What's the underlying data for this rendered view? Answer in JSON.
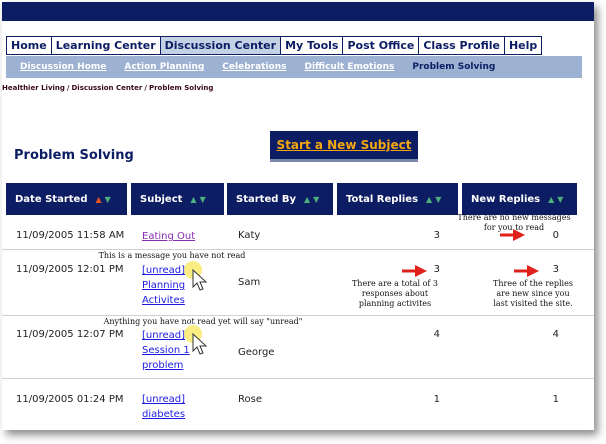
{
  "nav": {
    "tabs": [
      "Home",
      "Learning Center",
      "Discussion Center",
      "My Tools",
      "Post Office",
      "Class Profile",
      "Help"
    ],
    "active_tab": "Discussion Center"
  },
  "subnav": {
    "items": [
      "Discussion Home",
      "Action Planning",
      "Celebrations",
      "Difficult Emotions",
      "Problem Solving"
    ],
    "current": "Problem Solving"
  },
  "breadcrumb": [
    "Healthier Living",
    "Discussion Center",
    "Problem Solving"
  ],
  "page_title": "Problem Solving",
  "start_button": "Start a New Subject",
  "table": {
    "headers": [
      "Date Started",
      "Subject",
      "Started By",
      "Total Replies",
      "New Replies"
    ],
    "rows": [
      {
        "date": "11/09/2005 11:58 AM",
        "status": "",
        "subject_lines": [
          "Eating Out"
        ],
        "started_by": "Katy",
        "total": "3",
        "new": "0",
        "visited": true
      },
      {
        "date": "11/09/2005 12:01 PM",
        "status": "[unread]",
        "subject_lines": [
          "Planning",
          "Activites"
        ],
        "started_by": "Sam",
        "total": "3",
        "new": "3",
        "visited": false
      },
      {
        "date": "11/09/2005 12:07 PM",
        "status": "[unread]",
        "subject_lines": [
          "Session 1",
          "problem"
        ],
        "started_by": "George",
        "total": "4",
        "new": "4",
        "visited": false
      },
      {
        "date": "11/09/2005 01:24 PM",
        "status": "[unread]",
        "subject_lines": [
          "diabetes"
        ],
        "started_by": "Rose",
        "total": "1",
        "new": "1",
        "visited": false
      }
    ]
  },
  "annotations": {
    "no_new": [
      "There are no new messages",
      "for you to read"
    ],
    "unread_msg": "This is a message you have not read",
    "total_three": [
      "There are a total of 3",
      "responses about",
      "planning activites"
    ],
    "new_three": [
      "Three of the replies",
      "are new since you",
      "last visited the site."
    ],
    "anything_unread": "Anything you have not read yet will say \"unread\""
  },
  "colors": {
    "navy": "#0d1d63",
    "subnav": "#9db1d3",
    "button_text": "#f4a70f",
    "link": "#1b1be0",
    "visited_link": "#8a2cb0",
    "annotation_arrow": "#e0201b"
  }
}
